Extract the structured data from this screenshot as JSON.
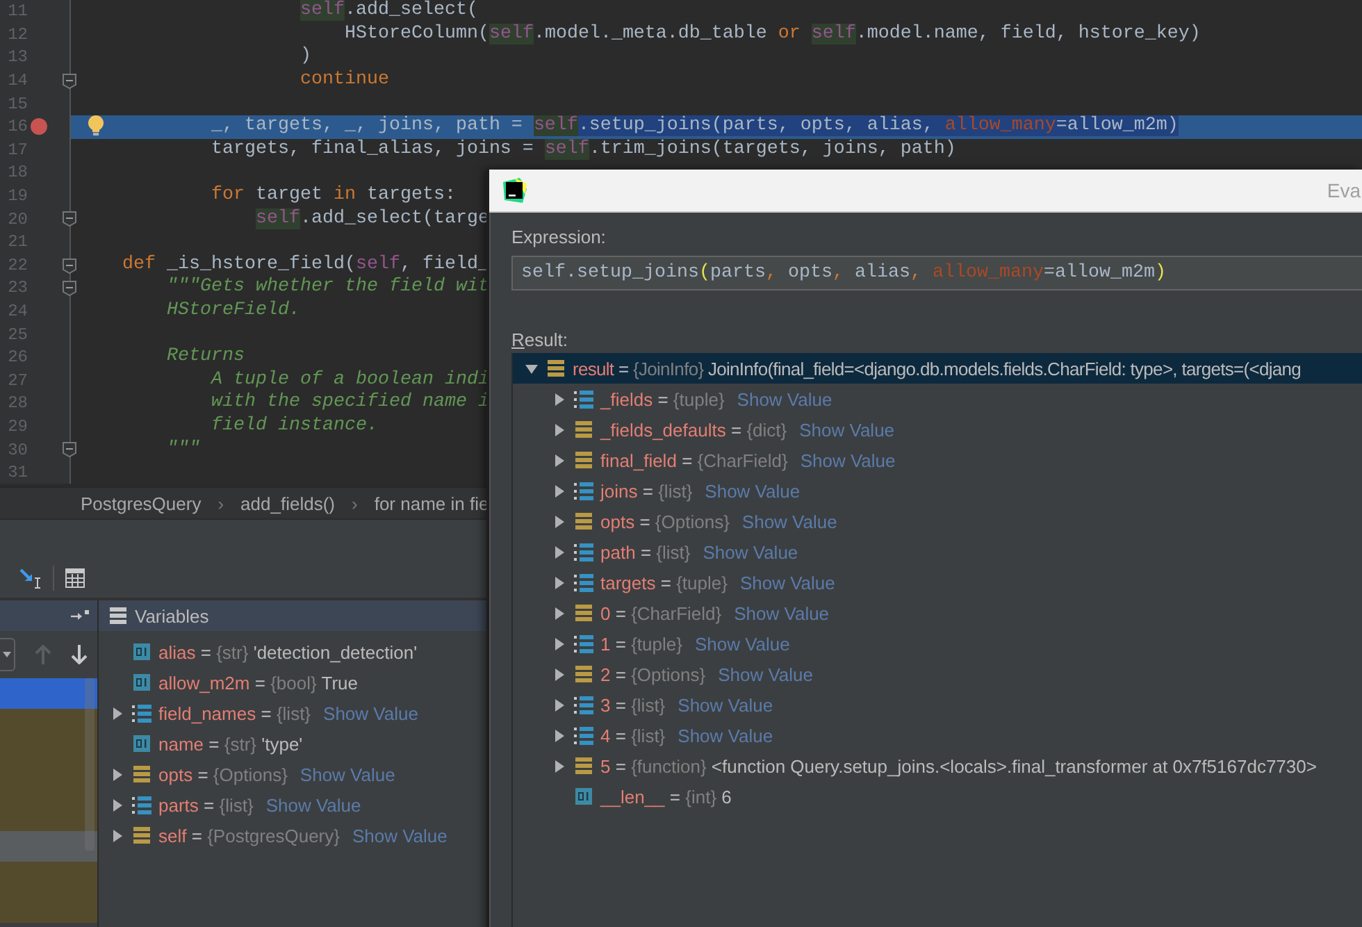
{
  "editor": {
    "lines": [
      {
        "n": "11",
        "breakpoint": false,
        "fold": false,
        "current": false,
        "tokens": [
          {
            "t": "                    self",
            "kind": "self"
          },
          {
            "t": ".add_select(",
            "kind": "plain"
          }
        ]
      },
      {
        "n": "12",
        "breakpoint": false,
        "fold": false,
        "current": false,
        "tokens": [
          {
            "t": "                        HStoreColumn(",
            "kind": "plain"
          },
          {
            "t": "self",
            "kind": "self"
          },
          {
            "t": ".model._meta.db_table ",
            "kind": "plain"
          },
          {
            "t": "or",
            "kind": "keyword"
          },
          {
            "t": " self",
            "kind": "self"
          },
          {
            "t": ".model.name, field, hstore_key)",
            "kind": "plain"
          }
        ]
      },
      {
        "n": "13",
        "breakpoint": false,
        "fold": false,
        "current": false,
        "tokens": [
          {
            "t": "                    )",
            "kind": "plain"
          }
        ]
      },
      {
        "n": "14",
        "breakpoint": false,
        "fold": true,
        "current": false,
        "tokens": [
          {
            "t": "                    continue",
            "kind": "keyword"
          }
        ]
      },
      {
        "n": "15",
        "breakpoint": false,
        "fold": false,
        "current": false
      },
      {
        "n": "16",
        "breakpoint": true,
        "fold": false,
        "current": true,
        "tokens": [
          {
            "t": "            _, targets, _, joins, path = ",
            "kind": "plain"
          }
        ],
        "selection": [
          {
            "t": "self",
            "kind": "self"
          },
          {
            "t": ".setup_joins(parts, opts, alias, ",
            "kind": "plain"
          },
          {
            "t": "allow_many",
            "kind": "kwarg"
          },
          {
            "t": "=allow_m2m)",
            "kind": "plain"
          }
        ]
      },
      {
        "n": "17",
        "breakpoint": false,
        "fold": false,
        "current": false,
        "tokens": [
          {
            "t": "            targets, final_alias, joins = ",
            "kind": "plain"
          },
          {
            "t": "self",
            "kind": "self"
          },
          {
            "t": ".trim_joins(targets, joins, path)",
            "kind": "plain"
          }
        ]
      },
      {
        "n": "18",
        "breakpoint": false,
        "fold": false,
        "current": false
      },
      {
        "n": "19",
        "breakpoint": false,
        "fold": false,
        "current": false,
        "tokens": [
          {
            "t": "            for",
            "kind": "keyword"
          },
          {
            "t": " target ",
            "kind": "plain"
          },
          {
            "t": "in",
            "kind": "keyword"
          },
          {
            "t": " targets:",
            "kind": "plain"
          }
        ]
      },
      {
        "n": "20",
        "breakpoint": false,
        "fold": true,
        "current": false,
        "tokens": [
          {
            "t": "                self",
            "kind": "self"
          },
          {
            "t": ".add_select(targe",
            "kind": "plain"
          }
        ]
      },
      {
        "n": "21",
        "breakpoint": false,
        "fold": false,
        "current": false
      },
      {
        "n": "22",
        "breakpoint": false,
        "fold": true,
        "current": false,
        "tokens": [
          {
            "t": "    def",
            "kind": "keyword"
          },
          {
            "t": " _is_hstore_field(",
            "kind": "plain"
          },
          {
            "t": "self",
            "kind": "param"
          },
          {
            "t": ", field_",
            "kind": "plain"
          }
        ]
      },
      {
        "n": "23",
        "breakpoint": false,
        "fold": true,
        "current": false,
        "tokens": [
          {
            "t": "        \"\"\"Gets whether the field wit",
            "kind": "docstring"
          }
        ]
      },
      {
        "n": "24",
        "breakpoint": false,
        "fold": false,
        "current": false,
        "tokens": [
          {
            "t": "        HStoreField.",
            "kind": "docstring"
          }
        ]
      },
      {
        "n": "25",
        "breakpoint": false,
        "fold": false,
        "current": false
      },
      {
        "n": "26",
        "breakpoint": false,
        "fold": false,
        "current": false,
        "tokens": [
          {
            "t": "        Returns",
            "kind": "docstring"
          }
        ]
      },
      {
        "n": "27",
        "breakpoint": false,
        "fold": false,
        "current": false,
        "tokens": [
          {
            "t": "            A tuple of a boolean indi",
            "kind": "docstring"
          }
        ]
      },
      {
        "n": "28",
        "breakpoint": false,
        "fold": false,
        "current": false,
        "tokens": [
          {
            "t": "            with the specified name i",
            "kind": "docstring"
          }
        ]
      },
      {
        "n": "29",
        "breakpoint": false,
        "fold": false,
        "current": false,
        "tokens": [
          {
            "t": "            field instance.",
            "kind": "docstring"
          }
        ]
      },
      {
        "n": "30",
        "breakpoint": false,
        "fold": true,
        "current": false,
        "tokens": [
          {
            "t": "        \"\"\"",
            "kind": "docstring"
          }
        ]
      },
      {
        "n": "31",
        "breakpoint": false,
        "fold": false,
        "current": false
      }
    ]
  },
  "breadcrumbs": [
    "PostgresQuery",
    "add_fields()",
    "for name in fie"
  ],
  "breadcrumb_separators": [
    "›",
    "›"
  ],
  "debugger": {
    "frames": [
      {
        "selected": true,
        "library": false
      },
      {
        "selected": false,
        "library": true
      },
      {
        "selected": false,
        "library": true
      },
      {
        "selected": false,
        "library": true
      },
      {
        "selected": false,
        "library": true
      },
      {
        "selected": false,
        "library": false
      },
      {
        "selected": false,
        "library": true
      },
      {
        "selected": false,
        "library": true
      }
    ],
    "variables_title": "Variables",
    "variables": [
      {
        "name": "alias",
        "eq": "=",
        "type": "{str}",
        "value": "'detection_detection'",
        "link": false,
        "kind": "primitive",
        "expandable": false,
        "selected": false
      },
      {
        "name": "allow_m2m",
        "eq": "=",
        "type": "{bool}",
        "value": "True",
        "link": false,
        "kind": "primitive",
        "expandable": false,
        "selected": false
      },
      {
        "name": "field_names",
        "eq": "=",
        "type": "{list}",
        "value": "Show Value",
        "link": true,
        "kind": "list",
        "expandable": true,
        "expanded": false,
        "selected": false
      },
      {
        "name": "name",
        "eq": "=",
        "type": "{str}",
        "value": "'type'",
        "link": false,
        "kind": "primitive",
        "expandable": false,
        "selected": false
      },
      {
        "name": "opts",
        "eq": "=",
        "type": "{Options}",
        "value": "Show Value",
        "link": true,
        "kind": "object",
        "expandable": true,
        "expanded": false,
        "selected": false
      },
      {
        "name": "parts",
        "eq": "=",
        "type": "{list}",
        "value": "Show Value",
        "link": true,
        "kind": "list",
        "expandable": true,
        "expanded": false,
        "selected": false
      },
      {
        "name": "self",
        "eq": "=",
        "type": "{PostgresQuery}",
        "value": "Show Value",
        "link": true,
        "kind": "object",
        "expandable": true,
        "expanded": false,
        "selected": false
      }
    ]
  },
  "evaluate": {
    "title": "Eva",
    "expression_label": "Expression:",
    "expression": [
      {
        "t": "self.setup_joins",
        "kind": "plain"
      },
      {
        "t": "(",
        "kind": "brace"
      },
      {
        "t": "parts",
        "kind": "plain"
      },
      {
        "t": ",",
        "kind": "comma"
      },
      {
        "t": " opts",
        "kind": "plain"
      },
      {
        "t": ",",
        "kind": "comma"
      },
      {
        "t": " alias",
        "kind": "plain"
      },
      {
        "t": ",",
        "kind": "comma"
      },
      {
        "t": " allow_many",
        "kind": "kwarg"
      },
      {
        "t": "=allow_m2m",
        "kind": "plain"
      },
      {
        "t": ")",
        "kind": "brace"
      }
    ],
    "result_label": "Result:",
    "result": [
      {
        "name": "result",
        "eq": "=",
        "type": "{JoinInfo}",
        "value": "JoinInfo(final_field=<django.db.models.fields.CharField: type>, targets=(<djang",
        "link": false,
        "kind": "object",
        "expandable": true,
        "expanded": true,
        "selected": true,
        "children": [
          {
            "name": "_fields",
            "eq": "=",
            "type": "{tuple}",
            "value": "Show Value",
            "link": true,
            "kind": "list",
            "expandable": true,
            "expanded": false,
            "selected": false
          },
          {
            "name": "_fields_defaults",
            "eq": "=",
            "type": "{dict}",
            "value": "Show Value",
            "link": true,
            "kind": "object",
            "expandable": true,
            "expanded": false,
            "selected": false
          },
          {
            "name": "final_field",
            "eq": "=",
            "type": "{CharField}",
            "value": "Show Value",
            "link": true,
            "kind": "object",
            "expandable": true,
            "expanded": false,
            "selected": false
          },
          {
            "name": "joins",
            "eq": "=",
            "type": "{list}",
            "value": "Show Value",
            "link": true,
            "kind": "list",
            "expandable": true,
            "expanded": false,
            "selected": false
          },
          {
            "name": "opts",
            "eq": "=",
            "type": "{Options}",
            "value": "Show Value",
            "link": true,
            "kind": "object",
            "expandable": true,
            "expanded": false,
            "selected": false
          },
          {
            "name": "path",
            "eq": "=",
            "type": "{list}",
            "value": "Show Value",
            "link": true,
            "kind": "list",
            "expandable": true,
            "expanded": false,
            "selected": false
          },
          {
            "name": "targets",
            "eq": "=",
            "type": "{tuple}",
            "value": "Show Value",
            "link": true,
            "kind": "list",
            "expandable": true,
            "expanded": false,
            "selected": false
          },
          {
            "name": "0",
            "eq": "=",
            "type": "{CharField}",
            "value": "Show Value",
            "link": true,
            "kind": "object",
            "expandable": true,
            "expanded": false,
            "selected": false
          },
          {
            "name": "1",
            "eq": "=",
            "type": "{tuple}",
            "value": "Show Value",
            "link": true,
            "kind": "list",
            "expandable": true,
            "expanded": false,
            "selected": false
          },
          {
            "name": "2",
            "eq": "=",
            "type": "{Options}",
            "value": "Show Value",
            "link": true,
            "kind": "object",
            "expandable": true,
            "expanded": false,
            "selected": false
          },
          {
            "name": "3",
            "eq": "=",
            "type": "{list}",
            "value": "Show Value",
            "link": true,
            "kind": "list",
            "expandable": true,
            "expanded": false,
            "selected": false
          },
          {
            "name": "4",
            "eq": "=",
            "type": "{list}",
            "value": "Show Value",
            "link": true,
            "kind": "list",
            "expandable": true,
            "expanded": false,
            "selected": false
          },
          {
            "name": "5",
            "eq": "=",
            "type": "{function}",
            "value": "<function Query.setup_joins.<locals>.final_transformer at 0x7f5167dc7730>",
            "link": false,
            "kind": "object",
            "expandable": true,
            "expanded": false,
            "selected": false
          },
          {
            "name": "__len__",
            "eq": "=",
            "type": "{int}",
            "value": "6",
            "link": false,
            "kind": "primitive",
            "expandable": false,
            "selected": false
          }
        ]
      }
    ]
  }
}
